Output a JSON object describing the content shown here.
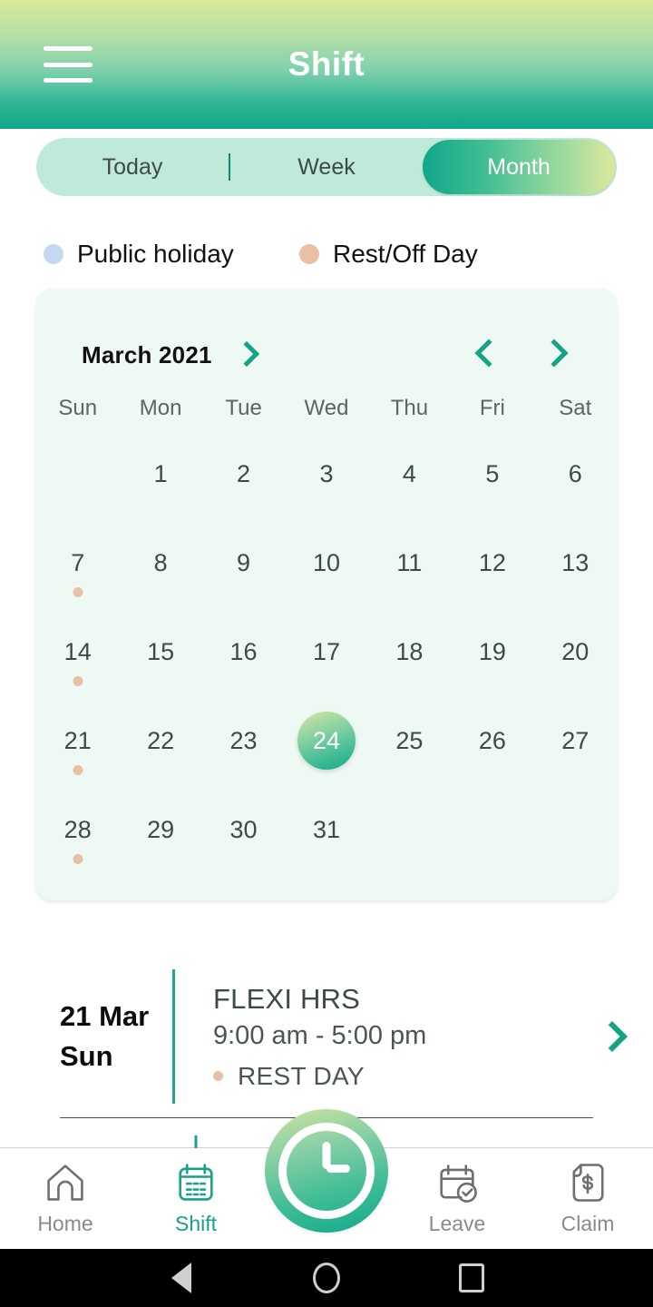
{
  "header": {
    "title": "Shift",
    "menu_icon": "hamburger-menu-icon"
  },
  "segment": {
    "items": [
      {
        "label": "Today",
        "active": false
      },
      {
        "label": "Week",
        "active": false
      },
      {
        "label": "Month",
        "active": true
      }
    ]
  },
  "legend": [
    {
      "label": "Public holiday",
      "color": "#c3d9f2"
    },
    {
      "label": "Rest/Off Day",
      "color": "#e9c0a6"
    }
  ],
  "calendar": {
    "month_label": "March 2021",
    "month_expand_icon": "chevron-right-icon",
    "prev_icon": "chevron-left-icon",
    "next_icon": "chevron-right-icon",
    "day_names": [
      "Sun",
      "Mon",
      "Tue",
      "Wed",
      "Thu",
      "Fri",
      "Sat"
    ],
    "selected_day": "24",
    "cells": [
      {
        "day": "",
        "mark": null
      },
      {
        "day": "1",
        "mark": null
      },
      {
        "day": "2",
        "mark": null
      },
      {
        "day": "3",
        "mark": null
      },
      {
        "day": "4",
        "mark": null
      },
      {
        "day": "5",
        "mark": null
      },
      {
        "day": "6",
        "mark": null
      },
      {
        "day": "7",
        "mark": "#e9c0a6"
      },
      {
        "day": "8",
        "mark": null
      },
      {
        "day": "9",
        "mark": null
      },
      {
        "day": "10",
        "mark": null
      },
      {
        "day": "11",
        "mark": null
      },
      {
        "day": "12",
        "mark": null
      },
      {
        "day": "13",
        "mark": null
      },
      {
        "day": "14",
        "mark": "#e9c0a6"
      },
      {
        "day": "15",
        "mark": null
      },
      {
        "day": "16",
        "mark": null
      },
      {
        "day": "17",
        "mark": null
      },
      {
        "day": "18",
        "mark": null
      },
      {
        "day": "19",
        "mark": null
      },
      {
        "day": "20",
        "mark": null
      },
      {
        "day": "21",
        "mark": "#e9c0a6"
      },
      {
        "day": "22",
        "mark": null
      },
      {
        "day": "23",
        "mark": null
      },
      {
        "day": "24",
        "mark": null
      },
      {
        "day": "25",
        "mark": null
      },
      {
        "day": "26",
        "mark": null
      },
      {
        "day": "27",
        "mark": null
      },
      {
        "day": "28",
        "mark": "#e9c0a6"
      },
      {
        "day": "29",
        "mark": null
      },
      {
        "day": "30",
        "mark": null
      },
      {
        "day": "31",
        "mark": null
      },
      {
        "day": "",
        "mark": null
      },
      {
        "day": "",
        "mark": null
      },
      {
        "day": "",
        "mark": null
      }
    ]
  },
  "detail": {
    "date_line1": "21 Mar",
    "date_line2": "Sun",
    "shift_name": "FLEXI HRS",
    "shift_time": "9:00 am - 5:00 pm",
    "tag_label": "REST DAY",
    "tag_color": "#e9c0a6",
    "chevron_icon": "chevron-right-icon"
  },
  "bottom_nav": {
    "items": [
      {
        "label": "Home",
        "icon": "home-icon",
        "active": false
      },
      {
        "label": "Shift",
        "icon": "calendar-icon",
        "active": true
      },
      {
        "label": "Leave",
        "icon": "calendar-check-icon",
        "active": false
      },
      {
        "label": "Claim",
        "icon": "document-dollar-icon",
        "active": false
      }
    ],
    "fab": {
      "icon": "clock-icon"
    }
  },
  "android_nav": {
    "back": "back-triangle-icon",
    "home": "home-circle-icon",
    "recents": "recents-square-icon"
  },
  "colors": {
    "accent_teal": "#17a387",
    "header_top": "#d8e99b",
    "header_bottom": "#0fa78a",
    "card_bg": "#eef9f4",
    "segment_bg": "#bfead9"
  }
}
